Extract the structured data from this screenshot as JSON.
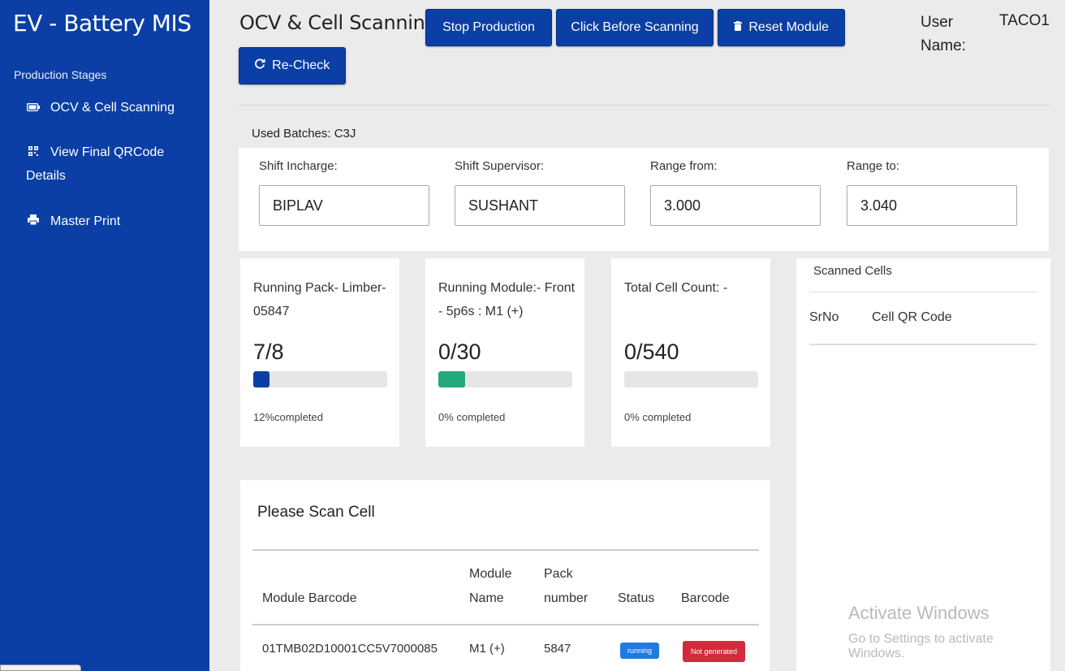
{
  "sidebar": {
    "brand": "EV - Battery MIS",
    "section_heading": "Production Stages",
    "items": [
      {
        "label": "OCV & Cell Scanning",
        "icon": "battery-icon"
      },
      {
        "label": "View Final QRCode Details",
        "icon": "qrcode-icon"
      },
      {
        "label": "Master Print",
        "icon": "print-icon"
      }
    ]
  },
  "header": {
    "title": "OCV & Cell Scanning",
    "buttons": {
      "stop": "Stop Production",
      "click_before": "Click Before Scanning",
      "reset": "Reset Module",
      "recheck": "Re-Check"
    },
    "user_label": "User Name:",
    "user_value": "TACO1"
  },
  "used_batches": "Used Batches: C3J",
  "shift": {
    "incharge_label": "Shift Incharge:",
    "incharge_value": "BIPLAV",
    "supervisor_label": "Shift Supervisor:",
    "supervisor_value": "SUSHANT",
    "range_from_label": "Range from:",
    "range_from_value": "3.000",
    "range_to_label": "Range to:",
    "range_to_value": "3.040"
  },
  "cards": [
    {
      "title": "Running Pack- Limber-05847",
      "count": "7/8",
      "progress": 0.12,
      "color": "#0b3fa5",
      "pct_text": "12%completed"
    },
    {
      "title": "Running Module:- Front - 5p6s : M1 (+)",
      "count": "0/30",
      "progress": 0.2,
      "color": "#25a87a",
      "pct_text": "0% completed"
    },
    {
      "title": "Total Cell Count: -",
      "count": "0/540",
      "progress": 0,
      "color": "#0b3fa5",
      "pct_text": "0% completed"
    }
  ],
  "scanned_cells": {
    "title": "Scanned Cells",
    "col_srno": "SrNo",
    "col_qr": "Cell QR Code"
  },
  "scan": {
    "title": "Please Scan Cell",
    "headers": [
      "Module Barcode",
      "Module Name",
      "Pack number",
      "Status",
      "Barcode"
    ],
    "row": {
      "module_barcode": "01TMB02D10001CC5V7000085",
      "module_name": "M1 (+)",
      "pack_number": "5847",
      "status": "running",
      "barcode": "Not generated"
    }
  },
  "watermark": {
    "line1": "Activate Windows",
    "line2": "Go to Settings to activate Windows."
  }
}
